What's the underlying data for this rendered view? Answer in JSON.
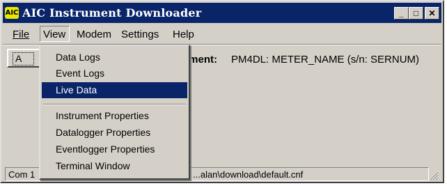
{
  "window": {
    "title": "AIC Instrument Downloader",
    "icon_text": "AIC",
    "controls": {
      "minimize": "_",
      "maximize": "□",
      "close": "✕"
    }
  },
  "menubar": {
    "file": "File",
    "view": "View",
    "modem": "Modem",
    "settings": "Settings",
    "help": "Help"
  },
  "toolbar": {
    "button_label": "A"
  },
  "instrument": {
    "label": "ument:",
    "value": "PM4DL: METER_NAME (s/n: SERNUM)"
  },
  "view_menu": {
    "items": [
      {
        "label": "Data Logs"
      },
      {
        "label": "Event Logs"
      },
      {
        "label": "Live Data"
      },
      {
        "label": "Instrument Properties"
      },
      {
        "label": "Datalogger Properties"
      },
      {
        "label": "Eventlogger Properties"
      },
      {
        "label": "Terminal Window"
      }
    ]
  },
  "statusbar": {
    "port": "Com 1",
    "config_path": "...alan\\download\\default.cnf"
  },
  "colors": {
    "title_bg": "#0a246a",
    "face": "#d4d0c8",
    "highlight": "#0a246a"
  }
}
